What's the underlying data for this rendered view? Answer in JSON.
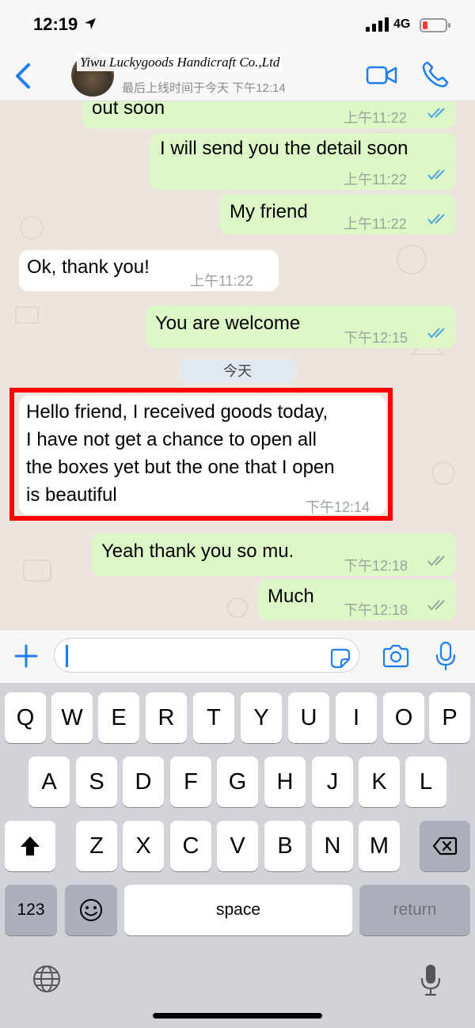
{
  "status_bar": {
    "time": "12:19",
    "network": "4G",
    "icons": [
      "location-arrow-icon",
      "signal-icon",
      "battery-icon"
    ]
  },
  "header": {
    "contact_name": "Yiwu Luckygoods Handicraft Co.,Ltd",
    "last_seen": "最后上线时间于今天 下午12:14",
    "icons": [
      "back-chevron-icon",
      "video-call-icon",
      "phone-icon"
    ]
  },
  "chat": {
    "messages": [
      {
        "direction": "out",
        "text": "out soon",
        "time": "上午11:22",
        "status": "read"
      },
      {
        "direction": "out",
        "text": "I will send you the detail soon",
        "time": "上午11:22",
        "status": "read"
      },
      {
        "direction": "out",
        "text": "My friend",
        "time": "上午11:22",
        "status": "read"
      },
      {
        "direction": "in",
        "text": "Ok, thank you!",
        "time": "上午11:22"
      },
      {
        "direction": "out",
        "text": "You are welcome",
        "time": "下午12:15",
        "status": "read"
      },
      {
        "direction": "in",
        "lines": [
          "Hello friend, I received goods today,",
          "I have not get a chance to open all",
          "the boxes yet but the one that I open",
          "is beautiful"
        ],
        "time": "下午12:14"
      },
      {
        "direction": "out",
        "text": "Yeah thank you so mu.",
        "time": "下午12:18",
        "status": "delivered"
      },
      {
        "direction": "out",
        "text": "Much",
        "time": "下午12:18",
        "status": "delivered"
      }
    ],
    "date_separator": "今天",
    "colors": {
      "outgoing": "#dcf8c6",
      "incoming": "#ffffff",
      "read_ticks": "#4fa3e0",
      "delivered_ticks": "#9aa49a",
      "highlight": "#ff0000"
    }
  },
  "input_bar": {
    "value": "",
    "icons": [
      "plus-icon",
      "sticker-icon",
      "camera-icon",
      "microphone-icon"
    ],
    "accent": "#1e7ef0"
  },
  "keyboard": {
    "row1": [
      "Q",
      "W",
      "E",
      "R",
      "T",
      "Y",
      "U",
      "I",
      "O",
      "P"
    ],
    "row2": [
      "A",
      "S",
      "D",
      "F",
      "G",
      "H",
      "J",
      "K",
      "L"
    ],
    "row3": [
      "Z",
      "X",
      "C",
      "V",
      "B",
      "N",
      "M"
    ],
    "numbers_key": "123",
    "space_key": "space",
    "return_key": "return",
    "icons": [
      "shift-icon",
      "backspace-icon",
      "emoji-icon",
      "globe-icon",
      "dictation-mic-icon"
    ]
  }
}
